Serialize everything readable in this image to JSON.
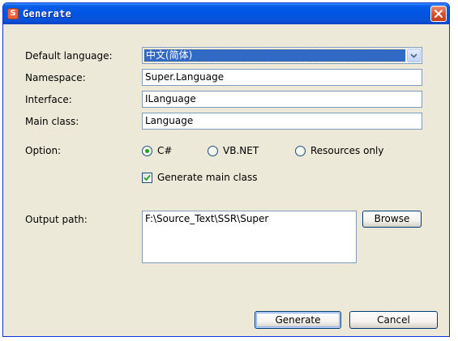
{
  "window": {
    "title": "Generate",
    "app_icon_glyph": "S",
    "icons": {
      "app": "ssr-app-icon",
      "close": "close-icon"
    }
  },
  "form": {
    "default_language": {
      "label": "Default language:",
      "value": "中文(简体)"
    },
    "namespace": {
      "label": "Namespace:",
      "value": "Super.Language"
    },
    "interface": {
      "label": "Interface:",
      "value": "ILanguage"
    },
    "main_class": {
      "label": "Main class:",
      "value": "Language"
    },
    "option": {
      "label": "Option:",
      "choices": [
        {
          "label": "C#",
          "selected": true
        },
        {
          "label": "VB.NET",
          "selected": false
        },
        {
          "label": "Resources only",
          "selected": false
        }
      ]
    },
    "generate_main_class": {
      "label": "Generate main class",
      "checked": true
    },
    "output_path": {
      "label": "Output path:",
      "value": "F:\\Source_Text\\SSR\\Super",
      "browse_label": "Browse"
    }
  },
  "buttons": {
    "generate": "Generate",
    "cancel": "Cancel"
  },
  "colors": {
    "titlebar": "#0054e3",
    "dialog_bg": "#ece9d8",
    "selection": "#316ac5",
    "radio_dot": "#21a121",
    "close_button": "#d9532c"
  }
}
